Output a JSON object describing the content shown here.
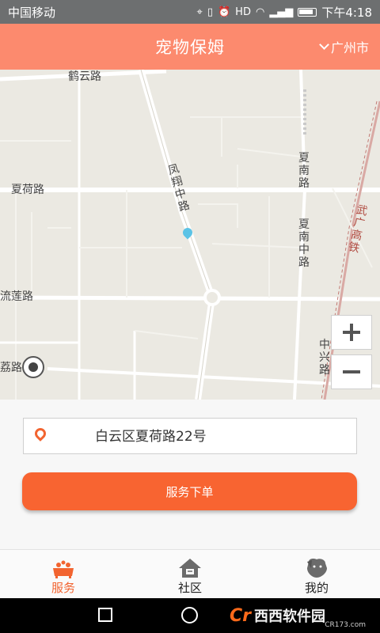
{
  "status_bar": {
    "carrier": "中国移动",
    "time": "下午4:18"
  },
  "header": {
    "title": "宠物保姆",
    "city": "广州市"
  },
  "map": {
    "labels": {
      "heyun_road": "鹤云路",
      "xiahe_road": "夏荷路",
      "fengxiang_mid_road": "凤翔中路",
      "xianan_road": "夏南路",
      "xianan_mid_road": "夏南中路",
      "liulian_road": "流莲路",
      "guangwu_railway": "武广高铁",
      "zhongxing_road": "中兴路",
      "li_road": "荔路"
    },
    "zoom_in": "+",
    "zoom_out": "−"
  },
  "address": {
    "value": "白云区夏荷路22号"
  },
  "order_button": {
    "label": "服务下单"
  },
  "tabs": [
    {
      "label": "服务",
      "icon": "bath-icon",
      "active": true
    },
    {
      "label": "社区",
      "icon": "home-icon",
      "active": false
    },
    {
      "label": "我的",
      "icon": "dog-icon",
      "active": false
    }
  ],
  "watermark": {
    "logo": "西西软件园",
    "sub": "CR173.com"
  },
  "colors": {
    "header_bg": "#fc8a6e",
    "accent": "#f86431",
    "map_bg": "#ebe9e2"
  }
}
